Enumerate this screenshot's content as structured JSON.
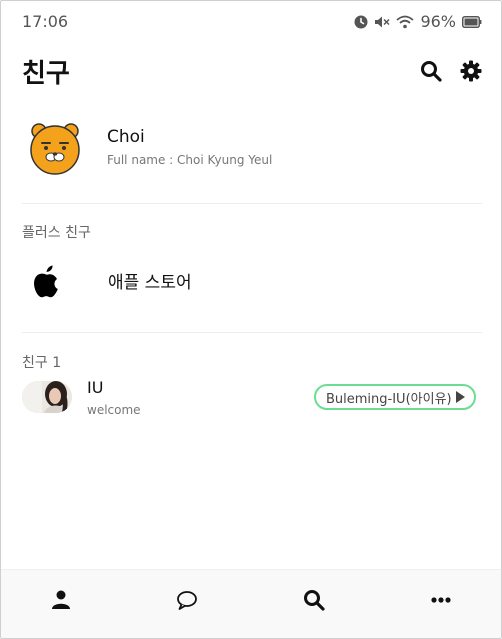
{
  "status_bar": {
    "time": "17:06",
    "battery_percent": "96%",
    "icons": [
      "alarm-clock-icon",
      "mute-icon",
      "wifi-icon",
      "battery-icon"
    ]
  },
  "header": {
    "title": "친구",
    "icons": [
      "search-icon",
      "gear-icon"
    ]
  },
  "profile": {
    "name": "Choi",
    "full_name": "Full name : Choi Kyung Yeul",
    "avatar": "ryan-avatar"
  },
  "plus_friends": {
    "label": "플러스 친구",
    "items": [
      {
        "name": "애플 스토어",
        "icon": "apple-logo-icon"
      }
    ]
  },
  "friends": {
    "label": "친구 1",
    "items": [
      {
        "name": "IU",
        "status_message": "welcome",
        "music": "Buleming-IU(아이유)",
        "music_icon": "play-icon"
      }
    ]
  },
  "bottom_nav": {
    "items": [
      "person-icon",
      "chat-bubble-icon",
      "search-icon",
      "more-icon"
    ]
  },
  "colors": {
    "music_border": "#6ddc93",
    "avatar_orange": "#f4a21c",
    "nav_background": "#f9f9f9"
  }
}
